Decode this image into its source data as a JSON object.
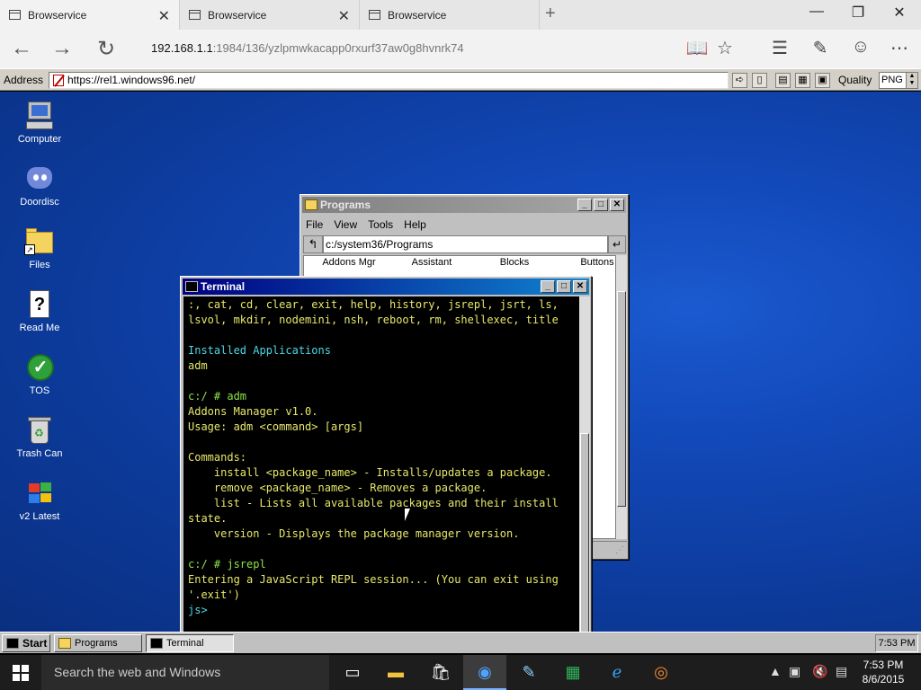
{
  "browser": {
    "tabs": [
      {
        "title": "Browservice",
        "active": true
      },
      {
        "title": "Browservice",
        "active": false
      },
      {
        "title": "Browservice",
        "active": false
      }
    ],
    "url_host": "192.168.1.1",
    "url_path": ":1984/136/yzlpmwkacapp0rxurf37aw0g8hvnrk74"
  },
  "browservice": {
    "address_label": "Address",
    "address_value": "https://rel1.windows96.net/",
    "quality_label": "Quality",
    "quality_value": "PNG"
  },
  "desktop": {
    "icons": [
      {
        "label": "Computer",
        "icon": "computer-icon"
      },
      {
        "label": "Doordisc",
        "icon": "discord-icon"
      },
      {
        "label": "Files",
        "icon": "folder-icon"
      },
      {
        "label": "Read Me",
        "icon": "readme-icon"
      },
      {
        "label": "TOS",
        "icon": "checkmark-icon"
      },
      {
        "label": "Trash Can",
        "icon": "trash-icon"
      },
      {
        "label": "v2 Latest",
        "icon": "windows-flag-icon"
      }
    ]
  },
  "programs_window": {
    "title": "Programs",
    "menu": [
      "File",
      "View",
      "Tools",
      "Help"
    ],
    "path": "c:/system36/Programs",
    "items": [
      "Addons Mgr",
      "Assistant",
      "Blocks",
      "Buttons"
    ],
    "partial_text": "t"
  },
  "terminal_window": {
    "title": "Terminal",
    "lines": [
      {
        "text": ":, cat, cd, clear, exit, help, history, jsrepl, jsrt, ls,",
        "color": "yellow"
      },
      {
        "text": "lsvol, mkdir, nodemini, nsh, reboot, rm, shellexec, title",
        "color": "yellow"
      },
      {
        "text": "",
        "color": "yellow"
      },
      {
        "text": "Installed Applications",
        "color": "cyan"
      },
      {
        "text": "adm",
        "color": "yellow"
      },
      {
        "text": "",
        "color": "yellow"
      },
      {
        "text": "c:/ # adm",
        "color": "green"
      },
      {
        "text": "Addons Manager v1.0.",
        "color": "yellow"
      },
      {
        "text": "Usage: adm <command> [args]",
        "color": "yellow"
      },
      {
        "text": "",
        "color": "yellow"
      },
      {
        "text": "Commands:",
        "color": "yellow"
      },
      {
        "text": "    install <package_name> - Installs/updates a package.",
        "color": "yellow"
      },
      {
        "text": "    remove <package_name> - Removes a package.",
        "color": "yellow"
      },
      {
        "text": "    list - Lists all available packages and their install",
        "color": "yellow"
      },
      {
        "text": "state.",
        "color": "yellow"
      },
      {
        "text": "    version - Displays the package manager version.",
        "color": "yellow"
      },
      {
        "text": "",
        "color": "yellow"
      },
      {
        "text": "c:/ # jsrepl",
        "color": "green"
      },
      {
        "text": "Entering a JavaScript REPL session... (You can exit using",
        "color": "yellow"
      },
      {
        "text": "'.exit')",
        "color": "yellow"
      },
      {
        "text": "js>",
        "color": "cyan"
      }
    ]
  },
  "w96_taskbar": {
    "start_label": "Start",
    "buttons": [
      "Programs",
      "Terminal"
    ],
    "clock": "7:53 PM"
  },
  "win10_taskbar": {
    "search_placeholder": "Search the web and Windows",
    "time": "7:53 PM",
    "date": "8/6/2015"
  },
  "colors": {
    "desktop_bg": "#1248b8",
    "terminal_title": "#000080",
    "terminal_text_yellow": "#e8e86a",
    "terminal_text_green": "#8fe34a",
    "terminal_text_cyan": "#4dd8e6"
  }
}
